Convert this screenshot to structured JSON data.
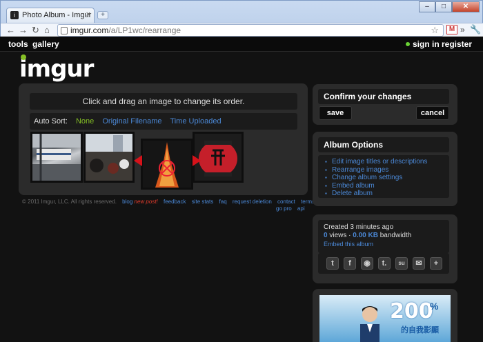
{
  "browser": {
    "tab_title": "Photo Album - Imgur",
    "tab_close": "×",
    "new_tab": "+",
    "win_min": "–",
    "win_max": "□",
    "win_close": "✕",
    "url_host": "imgur.com",
    "url_path": "/a/LP1wc/rearrange",
    "nav_back": "←",
    "nav_forward": "→",
    "nav_reload": "↻",
    "nav_home": "⌂",
    "star": "☆",
    "gmail": "M",
    "more": "»",
    "wrench": "🔧"
  },
  "topnav": {
    "tools": "tools",
    "gallery": "gallery",
    "signin": "sign in",
    "register": "register"
  },
  "logo": "imgur",
  "arrange": {
    "instruction": "Click and drag an image to change its order.",
    "auto_sort_label": "Auto Sort:",
    "sort_none": "None",
    "sort_filename": "Original Filename",
    "sort_time": "Time Uploaded"
  },
  "footer": {
    "copyright": "© 2011 Imgur, LLC. All rights reserved.",
    "blog": "blog",
    "new_post": "new post!",
    "feedback": "feedback",
    "site_stats": "site stats",
    "faq": "faq",
    "request_deletion": "request deletion",
    "contact": "contact",
    "terms": "terms",
    "go_pro": "go pro",
    "api": "api"
  },
  "confirm": {
    "title": "Confirm your changes",
    "save": "save",
    "cancel": "cancel"
  },
  "album_options": {
    "title": "Album Options",
    "items": [
      "Edit image titles or descriptions",
      "Rearrange images",
      "Change album settings",
      "Embed album",
      "Delete album"
    ]
  },
  "stats": {
    "created": "Created 3 minutes ago",
    "views_count": "0",
    "views_label": "views",
    "separator": "·",
    "bandwidth_value": "0.00 KB",
    "bandwidth_label": "bandwidth",
    "embed": "Embed this album"
  },
  "share_icons": [
    {
      "icon": "twitter-icon",
      "glyph": "t"
    },
    {
      "icon": "facebook-icon",
      "glyph": "f"
    },
    {
      "icon": "reddit-icon",
      "glyph": "◉"
    },
    {
      "icon": "tumblr-icon",
      "glyph": "t."
    },
    {
      "icon": "stumbleupon-icon",
      "glyph": "su"
    },
    {
      "icon": "email-icon",
      "glyph": "✉"
    },
    {
      "icon": "add-icon",
      "glyph": "+"
    }
  ],
  "ad": {
    "number": "200",
    "percent": "%",
    "subtitle": "的自我影顯"
  },
  "colors": {
    "accent_green": "#85bf25",
    "link_blue": "#4b88d6",
    "new_post_red": "#e03b2c",
    "page_bg": "#121212",
    "panel_bg": "#2b2b2b"
  }
}
